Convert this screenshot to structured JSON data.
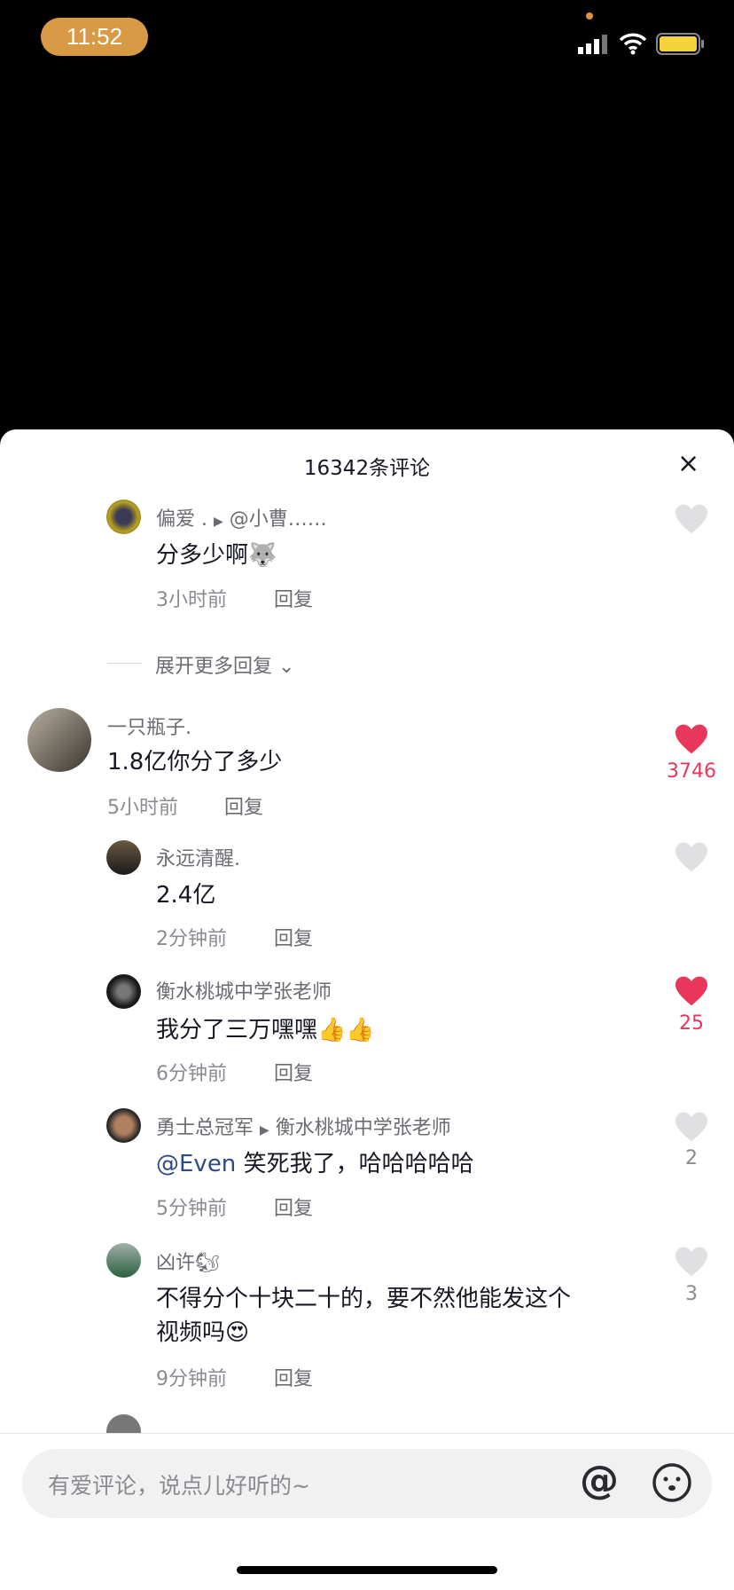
{
  "status": {
    "time": "11:52"
  },
  "header": {
    "title": "16342条评论",
    "close": "×"
  },
  "comments": [
    {
      "name": "偏爱 .",
      "reply_to": "@小曹……",
      "text": "分多少啊",
      "emoji": "🐺",
      "time": "3小时前",
      "reply": "回复",
      "likes": ""
    },
    {
      "expand": "展开更多回复"
    },
    {
      "name": "一只瓶子.",
      "text": "1.8亿你分了多少",
      "time": "5小时前",
      "reply": "回复",
      "likes": "3746"
    },
    {
      "name": "永远清醒.",
      "text": "2.4亿",
      "time": "2分钟前",
      "reply": "回复",
      "likes": ""
    },
    {
      "name": "衡水桃城中学张老师",
      "text": "我分了三万嘿嘿",
      "emoji": "👍👍",
      "time": "6分钟前",
      "reply": "回复",
      "likes": "25"
    },
    {
      "name": "勇士总冠军",
      "reply_to": "衡水桃城中学张老师",
      "mention": "@Even",
      "text": "笑死我了，哈哈哈哈哈",
      "time": "5分钟前",
      "reply": "回复",
      "likes": "2"
    },
    {
      "name": "凶许",
      "name_emoji": "🐿",
      "text": "不得分个十块二十的，要不然他能发这个",
      "text2": "视频吗",
      "emoji": "😍",
      "time": "9分钟前",
      "reply": "回复",
      "likes": "3"
    }
  ],
  "input": {
    "placeholder": "有爱评论，说点儿好听的~",
    "at": "@"
  },
  "colors": {
    "like": "#e8375a",
    "heart_empty": "#e0e0e2",
    "mention": "#2e4a86"
  }
}
